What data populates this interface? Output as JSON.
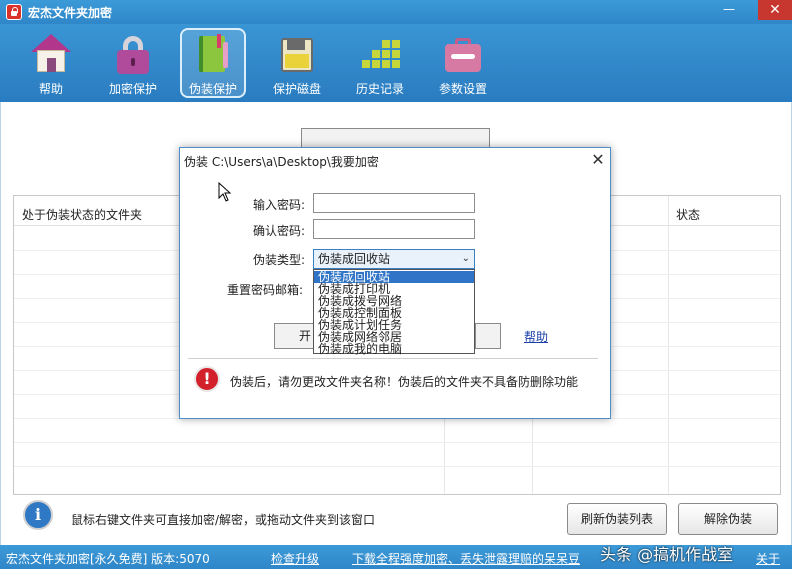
{
  "window": {
    "title": "宏杰文件夹加密",
    "minimize_label": "—",
    "maximize_label": "▭",
    "close_label": "✕"
  },
  "toolbar": {
    "items": [
      {
        "label": "帮助",
        "icon": "home-icon"
      },
      {
        "label": "加密保护",
        "icon": "lock-icon"
      },
      {
        "label": "伪装保护",
        "icon": "book-icon",
        "active": true
      },
      {
        "label": "保护磁盘",
        "icon": "disk-icon"
      },
      {
        "label": "历史记录",
        "icon": "history-icon"
      },
      {
        "label": "参数设置",
        "icon": "settings-icon"
      }
    ]
  },
  "list": {
    "col_folder": "处于伪装状态的文件夹",
    "col_status": "状态"
  },
  "hint": {
    "icon": "info-icon",
    "text": "鼠标右键文件夹可直接加密/解密，或拖动文件夹到该窗口"
  },
  "buttons": {
    "refresh": "刷新伪装列表",
    "decrypt": "解除伪装"
  },
  "statusbar": {
    "version": "宏杰文件夹加密[永久免费] 版本:5070",
    "check_update": "检查升级",
    "promo": "下载全程强度加密、丢失泄露理赔的呆呆豆",
    "watermark": "头条 @搞机作战室",
    "about": "关于"
  },
  "dialog": {
    "title": "伪装 C:\\Users\\a\\Desktop\\我要加密",
    "close_label": "✕",
    "password_label": "输入密码:",
    "password_value": "",
    "confirm_label": "确认密码:",
    "confirm_value": "",
    "type_label": "伪装类型:",
    "type_selected": "伪装成回收站",
    "email_label": "重置密码邮箱:",
    "options": [
      "伪装成回收站",
      "伪装成打印机",
      "伪装成拨号网络",
      "伪装成控制面板",
      "伪装成计划任务",
      "伪装成网络邻居",
      "伪装成我的电脑"
    ],
    "start_button": "开",
    "help_link": "帮助",
    "warning": "伪装后，请勿更改文件夹名称！伪装后的文件夹不具备防删除功能"
  },
  "colors": {
    "titlebar": "#3c9ad8",
    "selection": "#2f74c6",
    "warning": "#d3212b"
  }
}
